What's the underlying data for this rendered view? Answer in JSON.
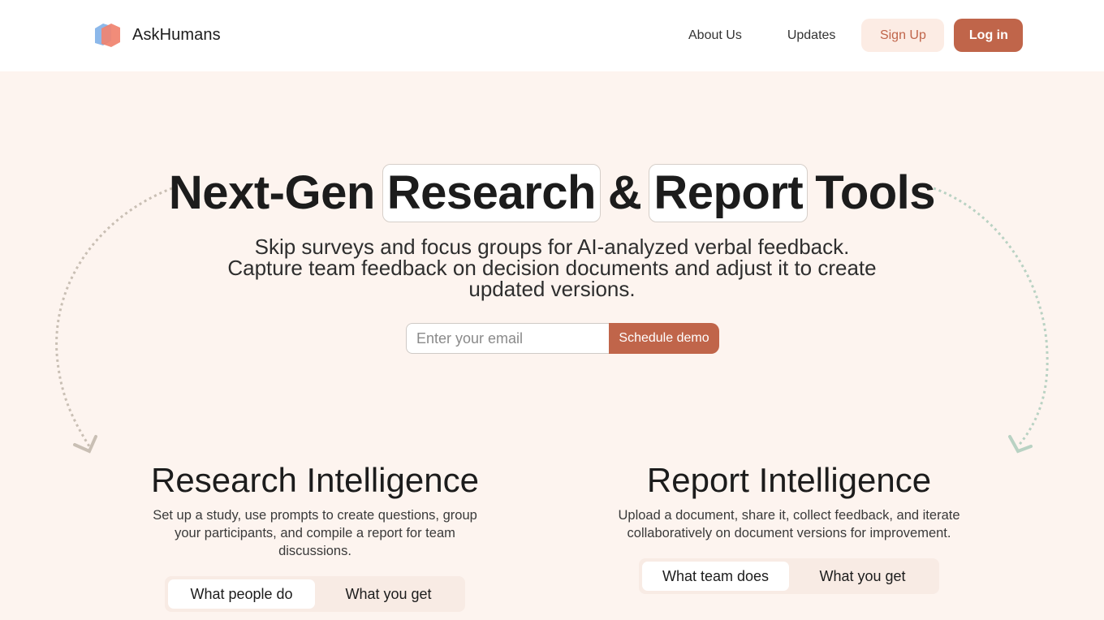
{
  "header": {
    "brand": "AskHumans",
    "nav": [
      {
        "label": "About Us"
      },
      {
        "label": "Updates"
      }
    ],
    "signup_label": "Sign Up",
    "login_label": "Log in"
  },
  "hero": {
    "title_parts": [
      "Next-Gen",
      "Research",
      "&",
      "Report",
      "Tools"
    ],
    "subtitle_line1": "Skip surveys and focus groups for AI-analyzed verbal feedback.",
    "subtitle_line2": "Capture team feedback on decision documents and adjust it to create updated versions.",
    "email_placeholder": "Enter your email",
    "email_value": "",
    "cta_label": "Schedule demo"
  },
  "sections": [
    {
      "title": "Research Intelligence",
      "description": "Set up a study, use prompts to create questions, group your participants, and compile a report for team discussions.",
      "tabs": [
        {
          "label": "What people do",
          "active": true
        },
        {
          "label": "What you get",
          "active": false
        }
      ]
    },
    {
      "title": "Report Intelligence",
      "description": "Upload a document, share it, collect feedback, and iterate collaboratively on document versions for improvement.",
      "tabs": [
        {
          "label": "What team does",
          "active": true
        },
        {
          "label": "What you get",
          "active": false
        }
      ]
    }
  ],
  "colors": {
    "accent": "#c0654a",
    "accent_light": "#fcece4",
    "page_bg": "#fdf4ef",
    "arrow_left": "#c9bfb4",
    "arrow_right": "#b9d2c3"
  },
  "icons": {
    "logo": "hexagon-logo-icon",
    "arrow_left": "dotted-curved-arrow-down-left-icon",
    "arrow_right": "dotted-curved-arrow-down-right-icon"
  }
}
